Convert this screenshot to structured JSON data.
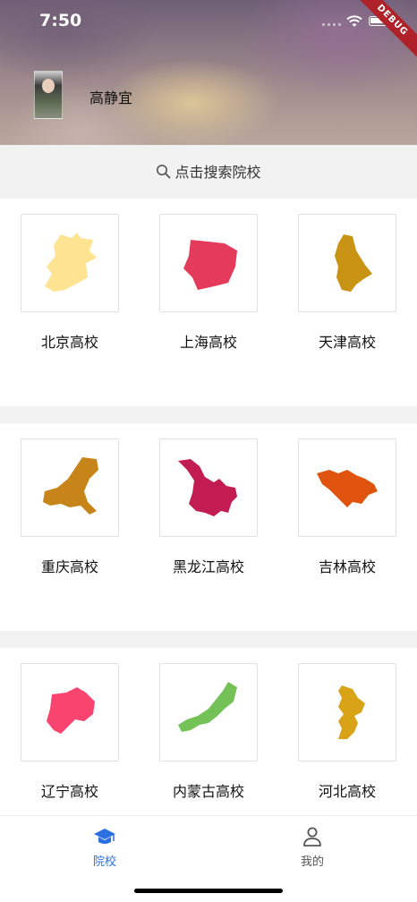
{
  "status_bar": {
    "time": "7:50",
    "debug_label": "DEBUG"
  },
  "profile": {
    "name": "高静宜"
  },
  "search": {
    "label": "点击搜索院校"
  },
  "provinces": [
    {
      "label": "北京高校",
      "color": "#fee392"
    },
    {
      "label": "上海高校",
      "color": "#e43a5c"
    },
    {
      "label": "天津高校",
      "color": "#c99314"
    },
    {
      "label": "重庆高校",
      "color": "#c78419"
    },
    {
      "label": "黑龙江高校",
      "color": "#c21c52"
    },
    {
      "label": "吉林高校",
      "color": "#e0530f"
    },
    {
      "label": "辽宁高校",
      "color": "#f9446f"
    },
    {
      "label": "内蒙古高校",
      "color": "#74c157"
    },
    {
      "label": "河北高校",
      "color": "#d8a317"
    }
  ],
  "tabs": [
    {
      "label": "院校",
      "icon": "graduation-cap-icon",
      "active": true,
      "color": "#2b6fe0"
    },
    {
      "label": "我的",
      "icon": "person-icon",
      "active": false,
      "color": "#555555"
    }
  ]
}
